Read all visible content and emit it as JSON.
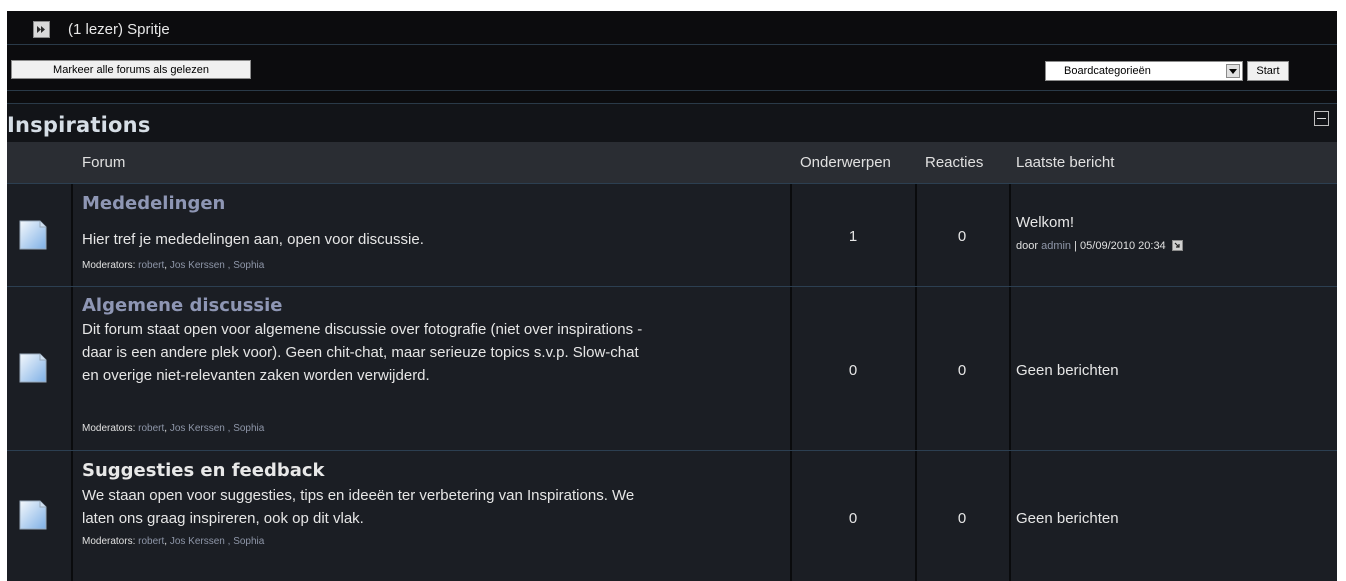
{
  "viewer": {
    "text": "(1 lezer) Spritje"
  },
  "actions": {
    "mark_read_label": "Markeer alle forums als gelezen",
    "select_value": "Boardcategorieën",
    "start_label": "Start"
  },
  "category": {
    "title": "Inspirations",
    "columns": {
      "forum": "Forum",
      "topics": "Onderwerpen",
      "replies": "Reacties",
      "last_post": "Laatste bericht"
    },
    "forums": [
      {
        "name": "Mededelingen",
        "name_color": "#8e96b4",
        "description": "Hier tref je mededelingen aan, open voor discussie.",
        "moderators_label": "Moderators:",
        "moderators": [
          "robert",
          "Jos Kerssen",
          ", Sophia"
        ],
        "topics": "1",
        "replies": "0",
        "last_title": "Welkom!",
        "last_by": "door",
        "last_user": "admin",
        "last_date": "| 05/09/2010 20:34"
      },
      {
        "name": "Algemene discussie",
        "name_color": "#8e96b4",
        "description_lines": [
          "Dit forum staat open voor algemene discussie over fotografie (niet over inspirations -",
          "daar is een andere plek voor). Geen chit-chat, maar serieuze topics s.v.p. Slow-chat",
          "en overige niet-relevanten zaken worden verwijderd."
        ],
        "moderators_label": "Moderators:",
        "moderators": [
          "robert",
          "Jos Kerssen",
          ", Sophia"
        ],
        "topics": "0",
        "replies": "0",
        "last_none": "Geen berichten"
      },
      {
        "name": "Suggesties en feedback",
        "name_color": "#e8e8e8",
        "description_lines": [
          "We staan open voor suggesties, tips en ideeën ter verbetering van Inspirations. We",
          "laten ons graag inspireren, ook op dit vlak."
        ],
        "moderators_label": "Moderators:",
        "moderators": [
          "robert",
          "Jos Kerssen",
          ", Sophia"
        ],
        "topics": "0",
        "replies": "0",
        "last_none": "Geen berichten"
      }
    ]
  },
  "icons": {
    "viewer": "double-arrow-right-icon",
    "forum": "forum-document-icon",
    "goto": "goto-last-post-icon",
    "collapse": "collapse-minus-icon",
    "dropdown": "chevron-down-icon"
  }
}
